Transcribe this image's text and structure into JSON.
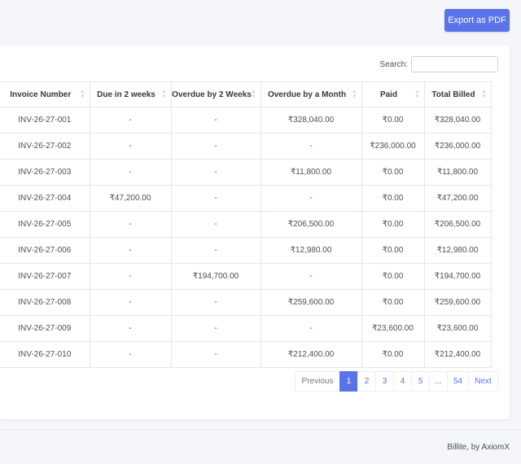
{
  "toolbar": {
    "export_label": "Export as PDF"
  },
  "search": {
    "label": "Search:",
    "value": ""
  },
  "table": {
    "columns": [
      "Invoice Number",
      "Due in 2 weeks",
      "Overdue by 2 Weeks",
      "Overdue by a Month",
      "Paid",
      "Total Billed"
    ],
    "rows": [
      [
        "INV-26-27-001",
        "-",
        "-",
        "₹328,040.00",
        "₹0.00",
        "₹328,040.00"
      ],
      [
        "INV-26-27-002",
        "-",
        "-",
        "-",
        "₹236,000.00",
        "₹236,000.00"
      ],
      [
        "INV-26-27-003",
        "-",
        "-",
        "₹11,800.00",
        "₹0.00",
        "₹11,800.00"
      ],
      [
        "INV-26-27-004",
        "₹47,200.00",
        "-",
        "-",
        "₹0.00",
        "₹47,200.00"
      ],
      [
        "INV-26-27-005",
        "-",
        "-",
        "₹206,500.00",
        "₹0.00",
        "₹206,500.00"
      ],
      [
        "INV-26-27-006",
        "-",
        "-",
        "₹12,980.00",
        "₹0.00",
        "₹12,980.00"
      ],
      [
        "INV-26-27-007",
        "-",
        "₹194,700.00",
        "-",
        "₹0.00",
        "₹194,700.00"
      ],
      [
        "INV-26-27-008",
        "-",
        "-",
        "₹259,600.00",
        "₹0.00",
        "₹259,600.00"
      ],
      [
        "INV-26-27-009",
        "-",
        "-",
        "-",
        "₹23,600.00",
        "₹23,600.00"
      ],
      [
        "INV-26-27-010",
        "-",
        "-",
        "₹212,400.00",
        "₹0.00",
        "₹212,400.00"
      ]
    ]
  },
  "pagination": {
    "previous": "Previous",
    "pages": [
      "1",
      "2",
      "3",
      "4",
      "5",
      "...",
      "54"
    ],
    "active": "1",
    "next": "Next"
  },
  "footer": {
    "text": "Billite, by AxiomX"
  },
  "colors": {
    "accent": "#5b73e8",
    "background": "#f4f6f9"
  },
  "icons": {
    "sort": "sort-both-icon"
  }
}
